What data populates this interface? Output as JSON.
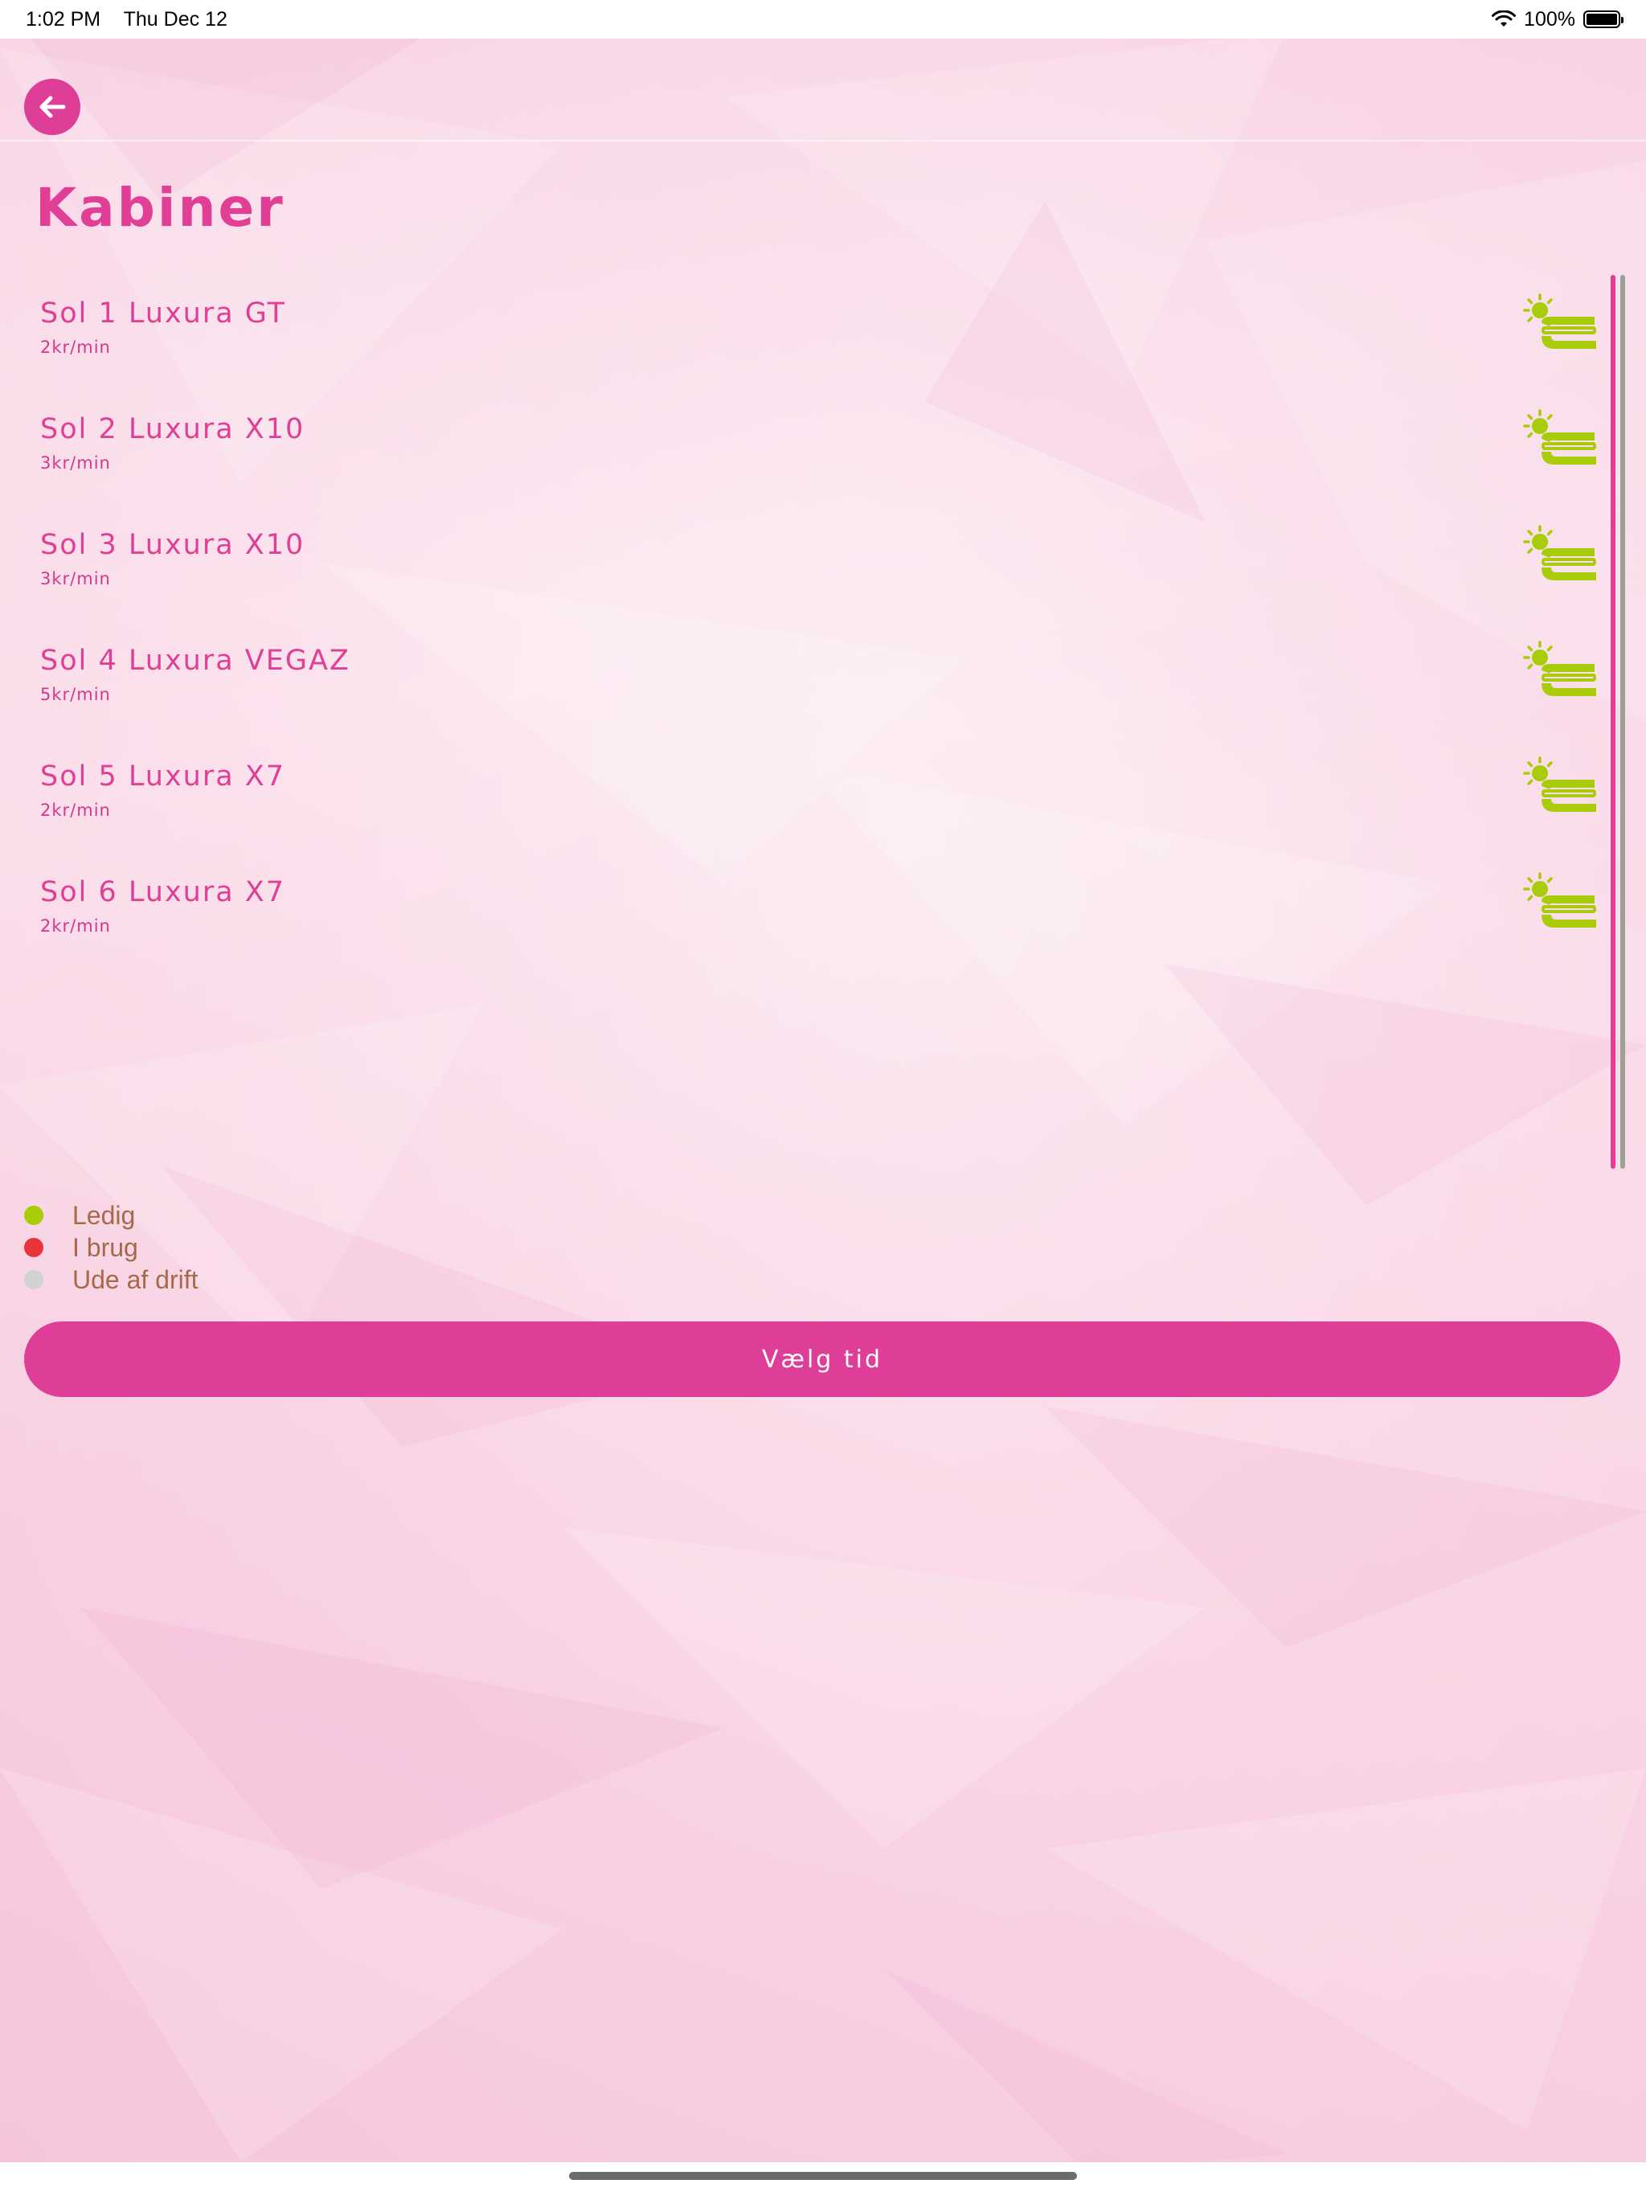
{
  "status_bar": {
    "time": "1:02 PM",
    "date": "Thu Dec 12",
    "battery": "100%",
    "wifi_icon": "wifi-icon",
    "battery_icon": "battery-icon"
  },
  "nav": {
    "back_icon": "arrow-left-icon"
  },
  "page": {
    "title": "Kabiner"
  },
  "cabins": [
    {
      "name": "Sol 1 Luxura GT",
      "price": "2kr/min",
      "status": "available"
    },
    {
      "name": "Sol 2 Luxura X10",
      "price": "3kr/min",
      "status": "available"
    },
    {
      "name": "Sol 3 Luxura X10",
      "price": "3kr/min",
      "status": "available"
    },
    {
      "name": "Sol 4 Luxura VEGAZ",
      "price": "5kr/min",
      "status": "available"
    },
    {
      "name": "Sol 5 Luxura X7",
      "price": "2kr/min",
      "status": "available"
    },
    {
      "name": "Sol 6 Luxura X7",
      "price": "2kr/min",
      "status": "available"
    }
  ],
  "legend": [
    {
      "label": "Ledig",
      "color": "#a8cc0a"
    },
    {
      "label": "I brug",
      "color": "#e8343a"
    },
    {
      "label": "Ude af drift",
      "color": "#d2d2d2"
    }
  ],
  "cta": {
    "label": "Vælg tid"
  },
  "colors": {
    "brand": "#de3d98",
    "available": "#a8cc0a"
  }
}
